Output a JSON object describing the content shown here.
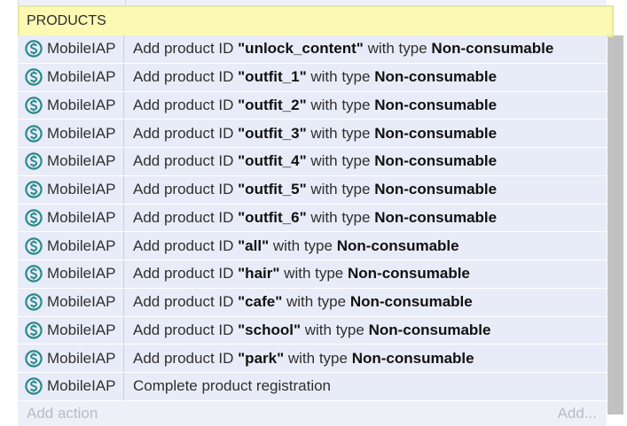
{
  "header": {
    "title": "PRODUCTS"
  },
  "icon_color": "#2a8a8a",
  "rows": [
    {
      "object": "MobileIAP",
      "prefix": "Add product ID ",
      "id": "\"unlock_content\"",
      "mid": " with type ",
      "type": "Non-consumable"
    },
    {
      "object": "MobileIAP",
      "prefix": "Add product ID ",
      "id": "\"outfit_1\"",
      "mid": " with type ",
      "type": "Non-consumable"
    },
    {
      "object": "MobileIAP",
      "prefix": "Add product ID ",
      "id": "\"outfit_2\"",
      "mid": " with type ",
      "type": "Non-consumable"
    },
    {
      "object": "MobileIAP",
      "prefix": "Add product ID ",
      "id": "\"outfit_3\"",
      "mid": " with type ",
      "type": "Non-consumable"
    },
    {
      "object": "MobileIAP",
      "prefix": "Add product ID ",
      "id": "\"outfit_4\"",
      "mid": " with type ",
      "type": "Non-consumable"
    },
    {
      "object": "MobileIAP",
      "prefix": "Add product ID ",
      "id": "\"outfit_5\"",
      "mid": " with type ",
      "type": "Non-consumable"
    },
    {
      "object": "MobileIAP",
      "prefix": "Add product ID ",
      "id": "\"outfit_6\"",
      "mid": " with type ",
      "type": "Non-consumable"
    },
    {
      "object": "MobileIAP",
      "prefix": "Add product ID ",
      "id": "\"all\"",
      "mid": " with type ",
      "type": "Non-consumable"
    },
    {
      "object": "MobileIAP",
      "prefix": "Add product ID ",
      "id": "\"hair\"",
      "mid": " with type ",
      "type": "Non-consumable"
    },
    {
      "object": "MobileIAP",
      "prefix": "Add product ID ",
      "id": "\"cafe\"",
      "mid": " with type ",
      "type": "Non-consumable"
    },
    {
      "object": "MobileIAP",
      "prefix": "Add product ID ",
      "id": "\"school\"",
      "mid": " with type ",
      "type": "Non-consumable"
    },
    {
      "object": "MobileIAP",
      "prefix": "Add product ID ",
      "id": "\"park\"",
      "mid": " with type ",
      "type": "Non-consumable"
    }
  ],
  "final_row": {
    "object": "MobileIAP",
    "text": "Complete product registration"
  },
  "footer": {
    "add_action": "Add action",
    "add": "Add..."
  }
}
